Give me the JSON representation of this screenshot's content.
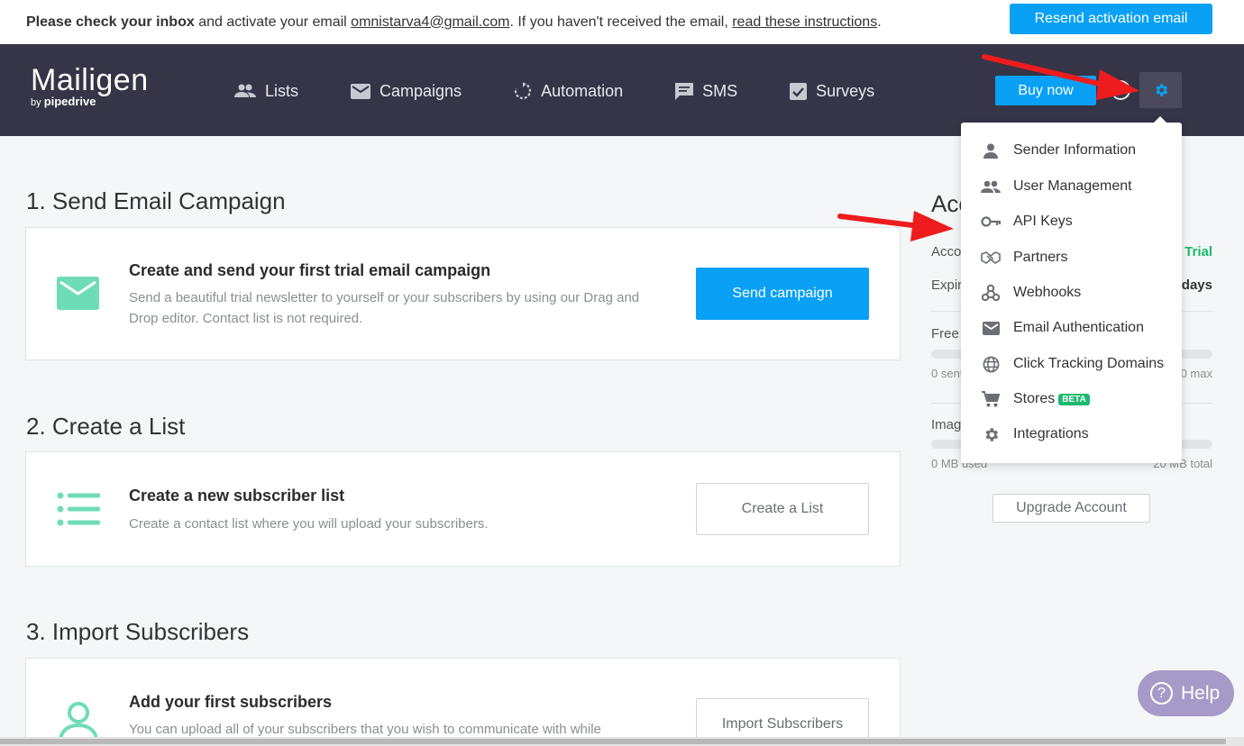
{
  "banner": {
    "strong": "Please check your inbox",
    "text1": " and activate your email ",
    "email": "omnistarva4@gmail.com",
    "text2": ". If you haven't received the email, ",
    "link": "read these instructions",
    "text3": ".",
    "resend_label": "Resend activation email"
  },
  "header": {
    "logo_word": "Mailigen",
    "logo_by": "by ",
    "logo_brand": "pipedrive",
    "nav": [
      {
        "label": "Lists",
        "icon": "people-icon"
      },
      {
        "label": "Campaigns",
        "icon": "envelope-icon"
      },
      {
        "label": "Automation",
        "icon": "automation-icon"
      },
      {
        "label": "SMS",
        "icon": "sms-icon"
      },
      {
        "label": "Surveys",
        "icon": "checkbox-icon"
      }
    ],
    "buy_label": "Buy now"
  },
  "sections": [
    {
      "heading": "1. Send Email Campaign",
      "title": "Create and send your first trial email campaign",
      "desc": "Send a beautiful trial newsletter to yourself or your subscribers by using our Drag and Drop editor. Contact list is not required.",
      "button": "Send campaign"
    },
    {
      "heading": "2. Create a List",
      "title": "Create a new subscriber list",
      "desc": "Create a contact list where you will upload your subscribers.",
      "button": "Create a List"
    },
    {
      "heading": "3. Import Subscribers",
      "title": "Add your first subscribers",
      "desc": "You can upload all of your subscribers that you wish to communicate with while",
      "button": "Import Subscribers"
    }
  ],
  "account": {
    "title": "Acc",
    "row1_label": "Acco",
    "row1_value": "Trial",
    "row2_label": "Expir",
    "row2_value": "days",
    "free_label": "Free",
    "free_used": "0 sent",
    "free_max": "0 max",
    "image_label": "Imag",
    "image_used": "0 MB used",
    "image_total": "20 MB total",
    "upgrade_label": "Upgrade Account"
  },
  "dropdown": {
    "items": [
      {
        "label": "Sender Information",
        "icon": "person-icon"
      },
      {
        "label": "User Management",
        "icon": "users-icon"
      },
      {
        "label": "API Keys",
        "icon": "key-icon"
      },
      {
        "label": "Partners",
        "icon": "handshake-icon"
      },
      {
        "label": "Webhooks",
        "icon": "webhook-icon"
      },
      {
        "label": "Email Authentication",
        "icon": "envelope-icon"
      },
      {
        "label": "Click Tracking Domains",
        "icon": "globe-icon"
      },
      {
        "label": "Stores",
        "icon": "cart-icon",
        "badge": "BETA"
      },
      {
        "label": "Integrations",
        "icon": "gear-icon"
      }
    ]
  },
  "help": {
    "label": "Help",
    "q": "?"
  },
  "colors": {
    "accent": "#0aa0f5",
    "header": "#363547",
    "mint": "#6fdcb8",
    "beta": "#1bb96e",
    "trial": "#1bb96e"
  }
}
